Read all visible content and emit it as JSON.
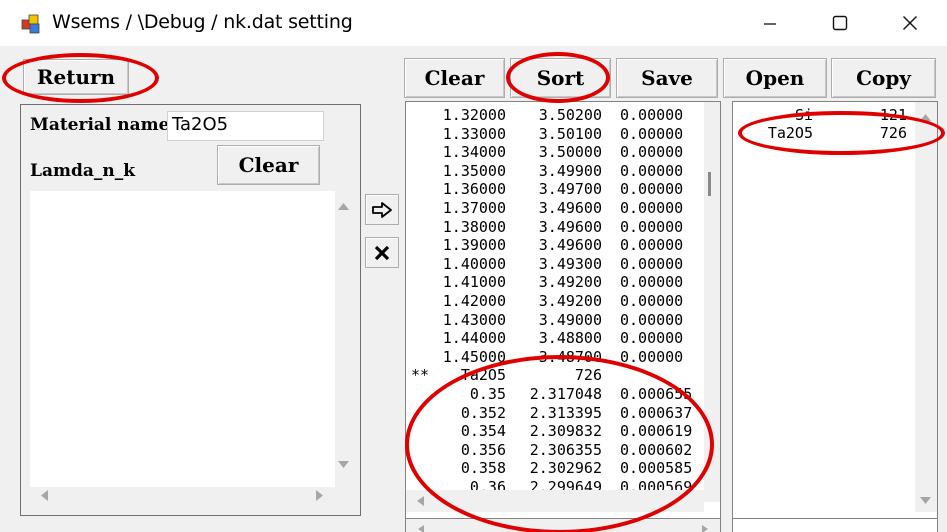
{
  "window": {
    "title": "Wsems / \\Debug / nk.dat setting",
    "minimize": "—",
    "maximize": "☐",
    "close": "✕"
  },
  "buttons": {
    "return": "Return",
    "clear_top": "Clear",
    "sort": "Sort",
    "save": "Save",
    "open": "Open",
    "copy": "Copy",
    "clear_left": "Clear"
  },
  "left_panel": {
    "material_label": "Material name",
    "material_value": "Ta2O5",
    "lamda_label": "Lamda_n_k"
  },
  "data_list": {
    "rows": [
      {
        "prefix": "",
        "a": "1.32000",
        "b": "3.50200",
        "c": "0.00000"
      },
      {
        "prefix": "",
        "a": "1.33000",
        "b": "3.50100",
        "c": "0.00000"
      },
      {
        "prefix": "",
        "a": "1.34000",
        "b": "3.50000",
        "c": "0.00000"
      },
      {
        "prefix": "",
        "a": "1.35000",
        "b": "3.49900",
        "c": "0.00000"
      },
      {
        "prefix": "",
        "a": "1.36000",
        "b": "3.49700",
        "c": "0.00000"
      },
      {
        "prefix": "",
        "a": "1.37000",
        "b": "3.49600",
        "c": "0.00000"
      },
      {
        "prefix": "",
        "a": "1.38000",
        "b": "3.49600",
        "c": "0.00000"
      },
      {
        "prefix": "",
        "a": "1.39000",
        "b": "3.49600",
        "c": "0.00000"
      },
      {
        "prefix": "",
        "a": "1.40000",
        "b": "3.49300",
        "c": "0.00000"
      },
      {
        "prefix": "",
        "a": "1.41000",
        "b": "3.49200",
        "c": "0.00000"
      },
      {
        "prefix": "",
        "a": "1.42000",
        "b": "3.49200",
        "c": "0.00000"
      },
      {
        "prefix": "",
        "a": "1.43000",
        "b": "3.49000",
        "c": "0.00000"
      },
      {
        "prefix": "",
        "a": "1.44000",
        "b": "3.48800",
        "c": "0.00000"
      },
      {
        "prefix": "",
        "a": "1.45000",
        "b": "3.48700",
        "c": "0.00000"
      },
      {
        "prefix": "**",
        "a": "Ta2O5",
        "b": "726",
        "c": ""
      },
      {
        "prefix": "",
        "a": "0.35",
        "b": "2.317048",
        "c": "0.000655"
      },
      {
        "prefix": "",
        "a": "0.352",
        "b": "2.313395",
        "c": "0.000637"
      },
      {
        "prefix": "",
        "a": "0.354",
        "b": "2.309832",
        "c": "0.000619"
      },
      {
        "prefix": "",
        "a": "0.356",
        "b": "2.306355",
        "c": "0.000602"
      },
      {
        "prefix": "",
        "a": "0.358",
        "b": "2.302962",
        "c": "0.000585"
      },
      {
        "prefix": "",
        "a": "0.36",
        "b": "2.299649",
        "c": "0.000569"
      }
    ]
  },
  "material_list": {
    "rows": [
      {
        "name": "Si",
        "count": "121"
      },
      {
        "name": "Ta2O5",
        "count": "726"
      }
    ]
  },
  "colors": {
    "highlight": "#e00000",
    "background": "#f0f0f0"
  },
  "icons": {
    "arrow_button": "right-arrow-icon",
    "delete_button": "close-x-icon"
  }
}
